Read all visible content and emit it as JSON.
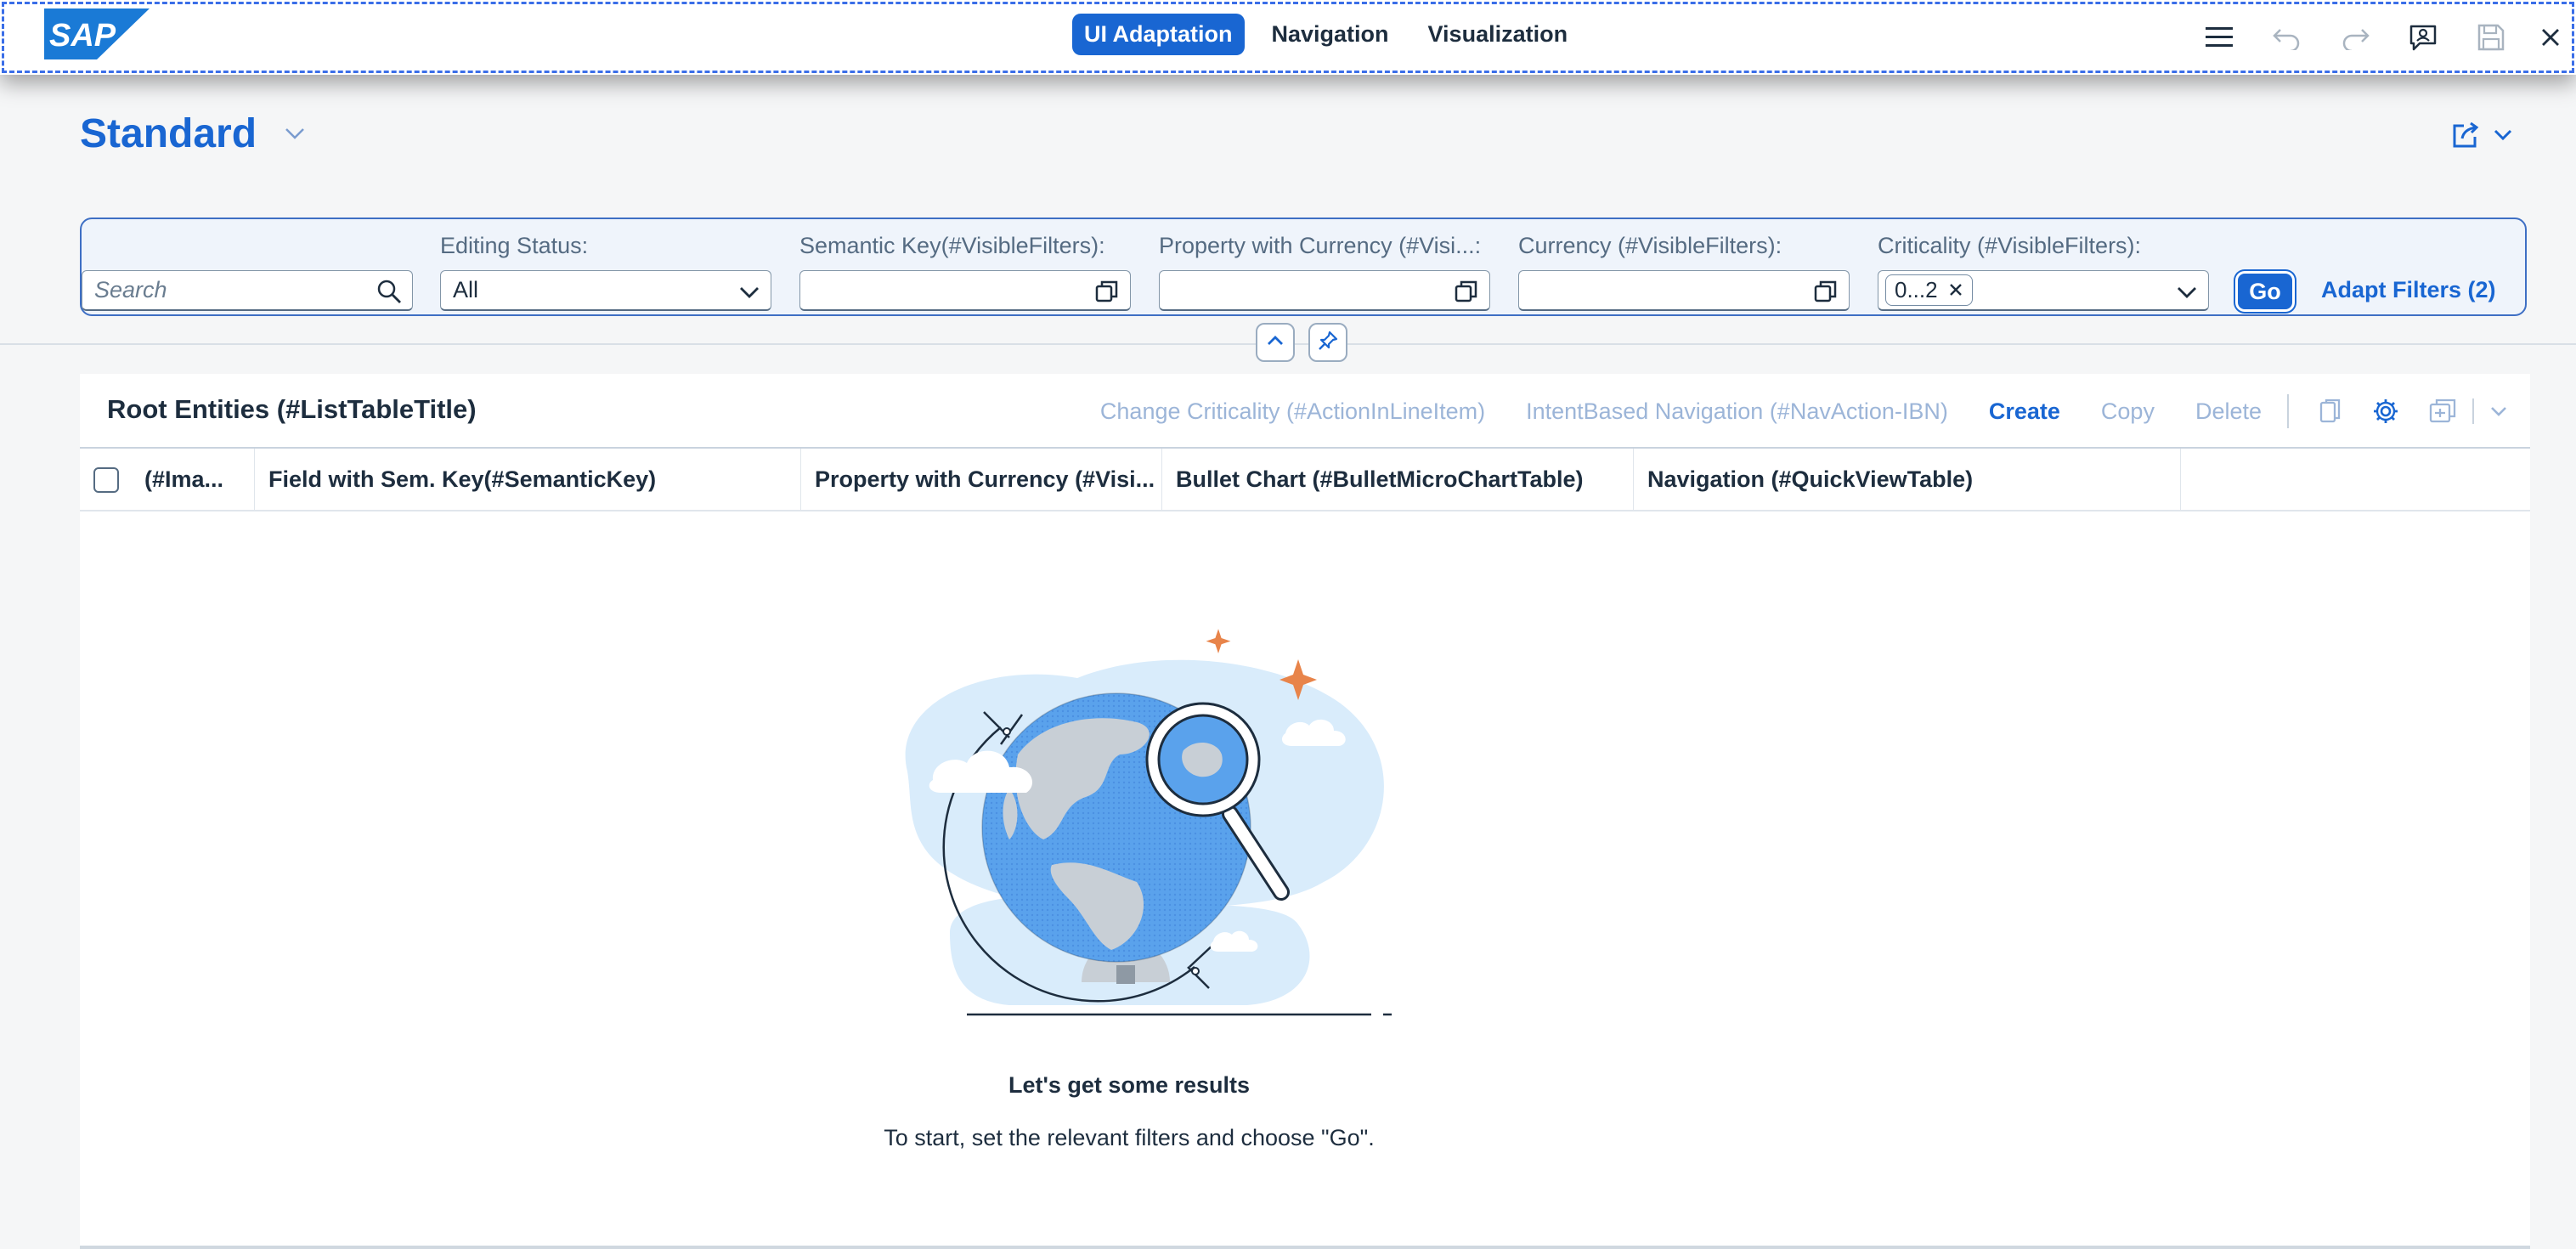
{
  "toolbar": {
    "logo_text": "SAP",
    "tabs": [
      {
        "label": "UI Adaptation",
        "active": true
      },
      {
        "label": "Navigation",
        "active": false
      },
      {
        "label": "Visualization",
        "active": false
      }
    ],
    "icons": [
      "menu-icon",
      "undo-icon",
      "redo-icon",
      "feedback-icon",
      "save-icon",
      "close-icon"
    ]
  },
  "header": {
    "title": "Standard"
  },
  "filterbar": {
    "search_placeholder": "Search",
    "filters": [
      {
        "label": "Editing Status:",
        "value": "All"
      },
      {
        "label": "Semantic Key(#VisibleFilters):",
        "value": ""
      },
      {
        "label": "Property with Currency (#Visi...:",
        "value": ""
      },
      {
        "label": "Currency (#VisibleFilters):",
        "value": ""
      },
      {
        "label": "Criticality (#VisibleFilters):",
        "token": "0...2"
      }
    ],
    "go_label": "Go",
    "adapt_label": "Adapt Filters (2)"
  },
  "table": {
    "title": "Root Entities (#ListTableTitle)",
    "actions": {
      "change_criticality": "Change Criticality (#ActionInLineItem)",
      "intent_nav": "IntentBased Navigation (#NavAction-IBN)",
      "create": "Create",
      "copy": "Copy",
      "delete": "Delete"
    },
    "columns": [
      "(#Ima...",
      "Field with Sem. Key(#SemanticKey)",
      "Property with Currency (#Visi...",
      "Bullet Chart (#BulletMicroChartTable)",
      "Navigation (#QuickViewTable)"
    ],
    "empty_title": "Let's get some results",
    "empty_text": "To start, set the relevant filters and choose \"Go\"."
  },
  "colors": {
    "accent": "#1966d2",
    "disabled_action": "#9cb5d8",
    "sparkle": "#e8844a"
  }
}
